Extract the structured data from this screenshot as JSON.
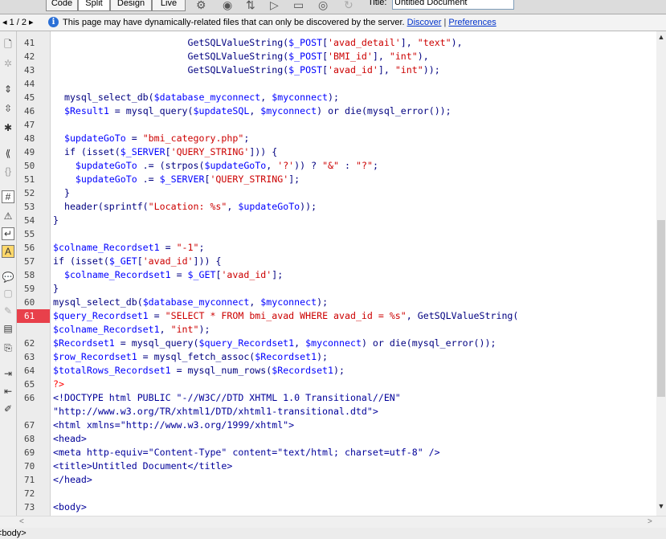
{
  "toolbar": {
    "views": [
      {
        "label": "Code",
        "active": false
      },
      {
        "label": "Split",
        "active": true
      },
      {
        "label": "Design",
        "active": false
      },
      {
        "label": "Live",
        "active": false
      }
    ],
    "title_label": "Title:",
    "title_value": "Untitled Document"
  },
  "infobar": {
    "pager": "◂ 1 / 2 ▸",
    "message": "This page may have dynamically-related files that can only be discovered by the server.",
    "discover_link": "Discover",
    "separator": "|",
    "preferences_link": "Preferences"
  },
  "editor": {
    "breakpoint_color": "#e8404b",
    "lines": [
      {
        "num": "41",
        "text": "                        GetSQLValueString($_POST['avad_detail'], \"text\"),"
      },
      {
        "num": "42",
        "text": "                        GetSQLValueString($_POST['BMI_id'], \"int\"),"
      },
      {
        "num": "43",
        "text": "                        GetSQLValueString($_POST['avad_id'], \"int\"));"
      },
      {
        "num": "44",
        "text": ""
      },
      {
        "num": "45",
        "text": "  mysql_select_db($database_myconnect, $myconnect);"
      },
      {
        "num": "46",
        "text": "  $Result1 = mysql_query($updateSQL, $myconnect) or die(mysql_error());"
      },
      {
        "num": "47",
        "text": ""
      },
      {
        "num": "48",
        "text": "  $updateGoTo = \"bmi_category.php\";"
      },
      {
        "num": "49",
        "text": "  if (isset($_SERVER['QUERY_STRING'])) {"
      },
      {
        "num": "50",
        "text": "    $updateGoTo .= (strpos($updateGoTo, '?')) ? \"&\" : \"?\";"
      },
      {
        "num": "51",
        "text": "    $updateGoTo .= $_SERVER['QUERY_STRING'];"
      },
      {
        "num": "52",
        "text": "  }"
      },
      {
        "num": "53",
        "text": "  header(sprintf(\"Location: %s\", $updateGoTo));"
      },
      {
        "num": "54",
        "text": "}"
      },
      {
        "num": "55",
        "text": ""
      },
      {
        "num": "56",
        "text": "$colname_Recordset1 = \"-1\";"
      },
      {
        "num": "57",
        "text": "if (isset($_GET['avad_id'])) {"
      },
      {
        "num": "58",
        "text": "  $colname_Recordset1 = $_GET['avad_id'];"
      },
      {
        "num": "59",
        "text": "}"
      },
      {
        "num": "60",
        "text": "mysql_select_db($database_myconnect, $myconnect);"
      },
      {
        "num": "61",
        "text": "$query_Recordset1 = \"SELECT * FROM bmi_avad WHERE avad_id = %s\", GetSQLValueString(",
        "breakpoint": true
      },
      {
        "num": "",
        "text": "$colname_Recordset1, \"int\");"
      },
      {
        "num": "62",
        "text": "$Recordset1 = mysql_query($query_Recordset1, $myconnect) or die(mysql_error());"
      },
      {
        "num": "63",
        "text": "$row_Recordset1 = mysql_fetch_assoc($Recordset1);"
      },
      {
        "num": "64",
        "text": "$totalRows_Recordset1 = mysql_num_rows($Recordset1);"
      },
      {
        "num": "65",
        "text": "?>"
      },
      {
        "num": "66",
        "text": "<!DOCTYPE html PUBLIC \"-//W3C//DTD XHTML 1.0 Transitional//EN\""
      },
      {
        "num": "",
        "text": "\"http://www.w3.org/TR/xhtml1/DTD/xhtml1-transitional.dtd\">"
      },
      {
        "num": "67",
        "text": "<html xmlns=\"http://www.w3.org/1999/xhtml\">"
      },
      {
        "num": "68",
        "text": "<head>"
      },
      {
        "num": "69",
        "text": "<meta http-equiv=\"Content-Type\" content=\"text/html; charset=utf-8\" />"
      },
      {
        "num": "70",
        "text": "<title>Untitled Document</title>"
      },
      {
        "num": "71",
        "text": "</head>"
      },
      {
        "num": "72",
        "text": ""
      },
      {
        "num": "73",
        "text": "<body>"
      }
    ]
  },
  "statusbar": {
    "tag": "<body>"
  }
}
